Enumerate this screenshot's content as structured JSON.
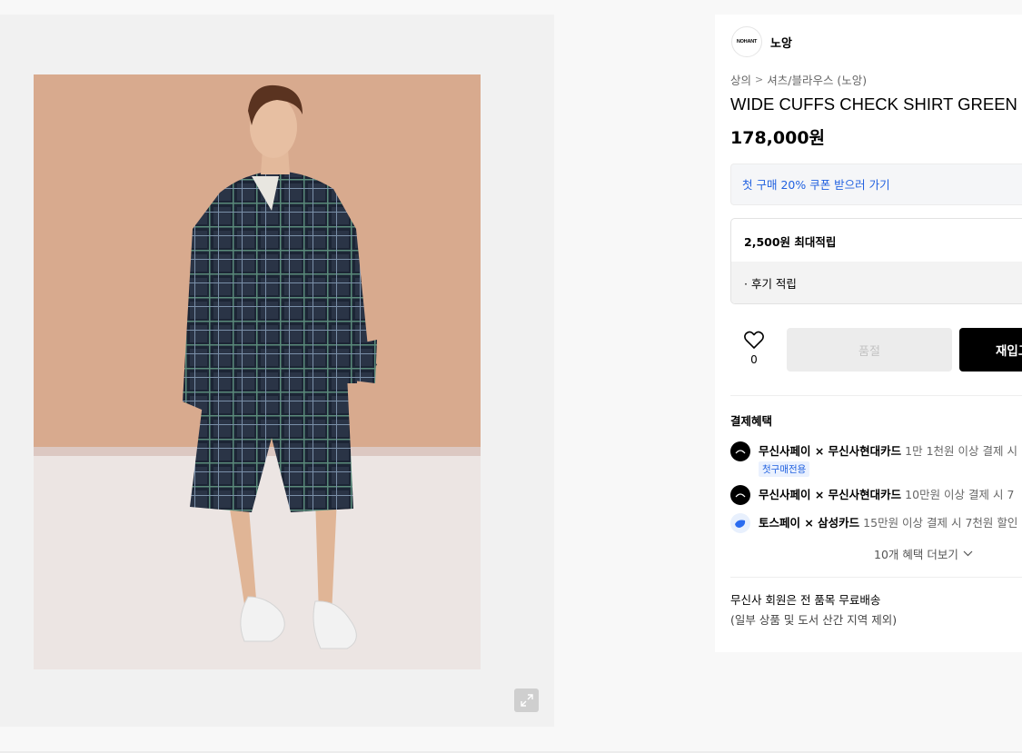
{
  "brand": {
    "logo_text": "NOHANT",
    "name": "노앙"
  },
  "breadcrumb": {
    "category": "상의",
    "separator": ">",
    "subcategory": "셔츠/블라우스 (노앙)"
  },
  "product": {
    "title": "WIDE CUFFS CHECK SHIRT GREEN",
    "price": "178,000원"
  },
  "coupon": {
    "label": "첫 구매 20% 쿠폰 받으러 가기"
  },
  "points": {
    "max_label": "2,500원 최대적립",
    "review_label": "· 후기 적립"
  },
  "actions": {
    "like_count": "0",
    "soldout_label": "품절",
    "restock_label": "재입고"
  },
  "benefits": {
    "title": "결제혜택",
    "items": [
      {
        "pay": "무신사페이 × 무신사현대카드",
        "desc": "1만 1천원 이상 결제 시",
        "badge": "첫구매전용"
      },
      {
        "pay": "무신사페이 × 무신사현대카드",
        "desc": "10만원 이상 결제 시 7"
      },
      {
        "pay": "토스페이 × 삼성카드",
        "desc": "15만원 이상 결제 시 7천원 할인"
      }
    ],
    "more_label": "10개 혜택 더보기"
  },
  "shipping": {
    "line1": "무신사 회원은 전 품목 무료배송",
    "line2": "(일부 상품 및 도서 산간 지역 제외)"
  },
  "colors": {
    "accent_blue": "#2262e0",
    "background_photo": "#dcb39a",
    "button_black": "#000000",
    "soldout_gray": "#ececec"
  }
}
